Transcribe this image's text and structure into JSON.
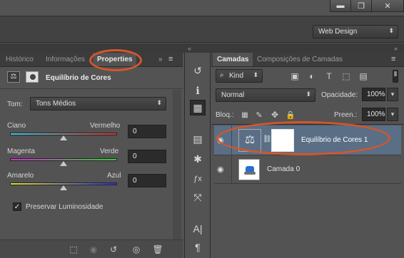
{
  "window": {
    "minimize_glyph": "▬",
    "restore_glyph": "❐",
    "close_glyph": "✕"
  },
  "workspace": {
    "selected": "Web Design"
  },
  "left_panel": {
    "tabs": [
      {
        "label": "Histórico"
      },
      {
        "label": "Informações"
      },
      {
        "label": "Properties"
      }
    ],
    "title": "Equilíbrio de Cores",
    "tone_label": "Tom:",
    "tone_value": "Tons Médios",
    "sliders": [
      {
        "left": "Ciano",
        "right": "Vermelho",
        "value": "0",
        "level": 0.5,
        "gradient": [
          "#2fd3e6",
          "#e23030"
        ]
      },
      {
        "left": "Magenta",
        "right": "Verde",
        "value": "0",
        "level": 0.5,
        "gradient": [
          "#d22cd2",
          "#2fd22f"
        ]
      },
      {
        "left": "Amarelo",
        "right": "Azul",
        "value": "0",
        "level": 0.5,
        "gradient": [
          "#e0e02c",
          "#2c2ce0"
        ]
      }
    ],
    "preserve_label": "Preservar Luminosidade",
    "preserve_checked": true,
    "preserve_check_glyph": "✓"
  },
  "tool_strip": [
    "history-brush",
    "info",
    "properties",
    "swatches",
    "styles",
    "fx",
    "paths",
    "character",
    "paragraph"
  ],
  "tool_glyphs": {
    "history_brush": "↺",
    "info": "ℹ",
    "properties": "▦",
    "swatches": "▤",
    "styles": "✱",
    "fx": "ƒx",
    "paths": "⤧",
    "character": "A|",
    "paragraph": "¶"
  },
  "right_panel": {
    "tabs": [
      {
        "label": "Camadas"
      },
      {
        "label": "Composições de Camadas"
      }
    ],
    "filter_kind": "Kind",
    "blend_mode": "Normal",
    "opacity_label": "Opacidade:",
    "opacity_value": "100%",
    "lock_label": "Bloq.:",
    "fill_label": "Preen.:",
    "fill_value": "100%",
    "layers": [
      {
        "name": "Equilíbrio de Cores 1",
        "type": "adjustment",
        "visible": true,
        "selected": true
      },
      {
        "name": "Camada 0",
        "type": "pixel",
        "visible": true,
        "selected": false
      }
    ]
  },
  "colors": {
    "annotation": "#d4562b",
    "panel_bg": "#535353",
    "selected_layer": "#5a6f86"
  }
}
